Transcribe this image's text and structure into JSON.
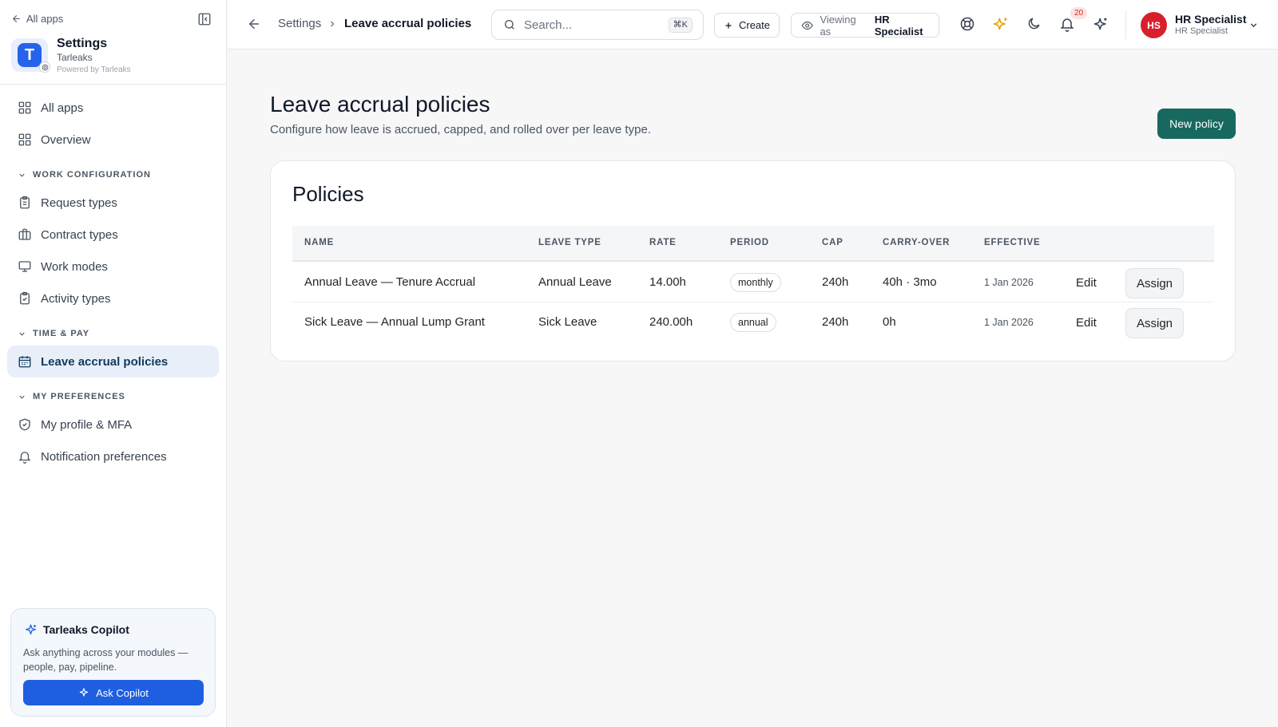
{
  "sidebar": {
    "all_apps_link": "All apps",
    "app": {
      "title": "Settings",
      "subtitle": "Tarleaks",
      "powered": "Powered by Tarleaks",
      "logo_letter": "T"
    },
    "items": [
      {
        "label": "All apps",
        "icon": "grid-icon"
      },
      {
        "label": "Overview",
        "icon": "grid-icon"
      }
    ],
    "sections": [
      {
        "heading": "WORK CONFIGURATION",
        "items": [
          {
            "label": "Request types",
            "icon": "clipboard-icon"
          },
          {
            "label": "Contract types",
            "icon": "briefcase-icon"
          },
          {
            "label": "Work modes",
            "icon": "monitor-icon"
          },
          {
            "label": "Activity types",
            "icon": "clipboard-check-icon"
          }
        ]
      },
      {
        "heading": "TIME & PAY",
        "items": [
          {
            "label": "Leave accrual policies",
            "icon": "calendar-icon",
            "active": true
          }
        ]
      },
      {
        "heading": "MY PREFERENCES",
        "items": [
          {
            "label": "My profile & MFA",
            "icon": "shield-check-icon"
          },
          {
            "label": "Notification preferences",
            "icon": "bell-icon"
          }
        ]
      }
    ],
    "copilot": {
      "title": "Tarleaks Copilot",
      "description": "Ask anything across your modules — people, pay, pipeline.",
      "button": "Ask Copilot"
    }
  },
  "topbar": {
    "breadcrumb": [
      "Settings",
      "Leave accrual policies"
    ],
    "search": {
      "placeholder": "Search...",
      "shortcut": "⌘K"
    },
    "create_label": "Create",
    "viewing": {
      "prefix": "Viewing as",
      "role": "HR Specialist"
    },
    "notifications_count": "20",
    "user": {
      "initials": "HS",
      "name": "HR Specialist",
      "role": "HR Specialist"
    }
  },
  "main": {
    "title": "Leave accrual policies",
    "subtitle": "Configure how leave is accrued, capped, and rolled over per leave type.",
    "new_policy_label": "New policy",
    "card_title": "Policies",
    "columns": [
      "NAME",
      "LEAVE TYPE",
      "RATE",
      "PERIOD",
      "CAP",
      "CARRY-OVER",
      "EFFECTIVE"
    ],
    "rows": [
      {
        "name": "Annual Leave — Tenure Accrual",
        "leave_type": "Annual Leave",
        "rate": "14.00h",
        "period": "monthly",
        "cap": "240h",
        "carry_over": "40h · 3mo",
        "effective": "1 Jan 2026",
        "edit": "Edit",
        "assign": "Assign"
      },
      {
        "name": "Sick Leave — Annual Lump Grant",
        "leave_type": "Sick Leave",
        "rate": "240.00h",
        "period": "annual",
        "cap": "240h",
        "carry_over": "0h",
        "effective": "1 Jan 2026",
        "edit": "Edit",
        "assign": "Assign"
      }
    ]
  },
  "colors": {
    "accent": "#17695f",
    "primary_blue": "#1d5fe0",
    "active_nav_bg": "#e9eff8",
    "avatar": "#d8202c"
  }
}
